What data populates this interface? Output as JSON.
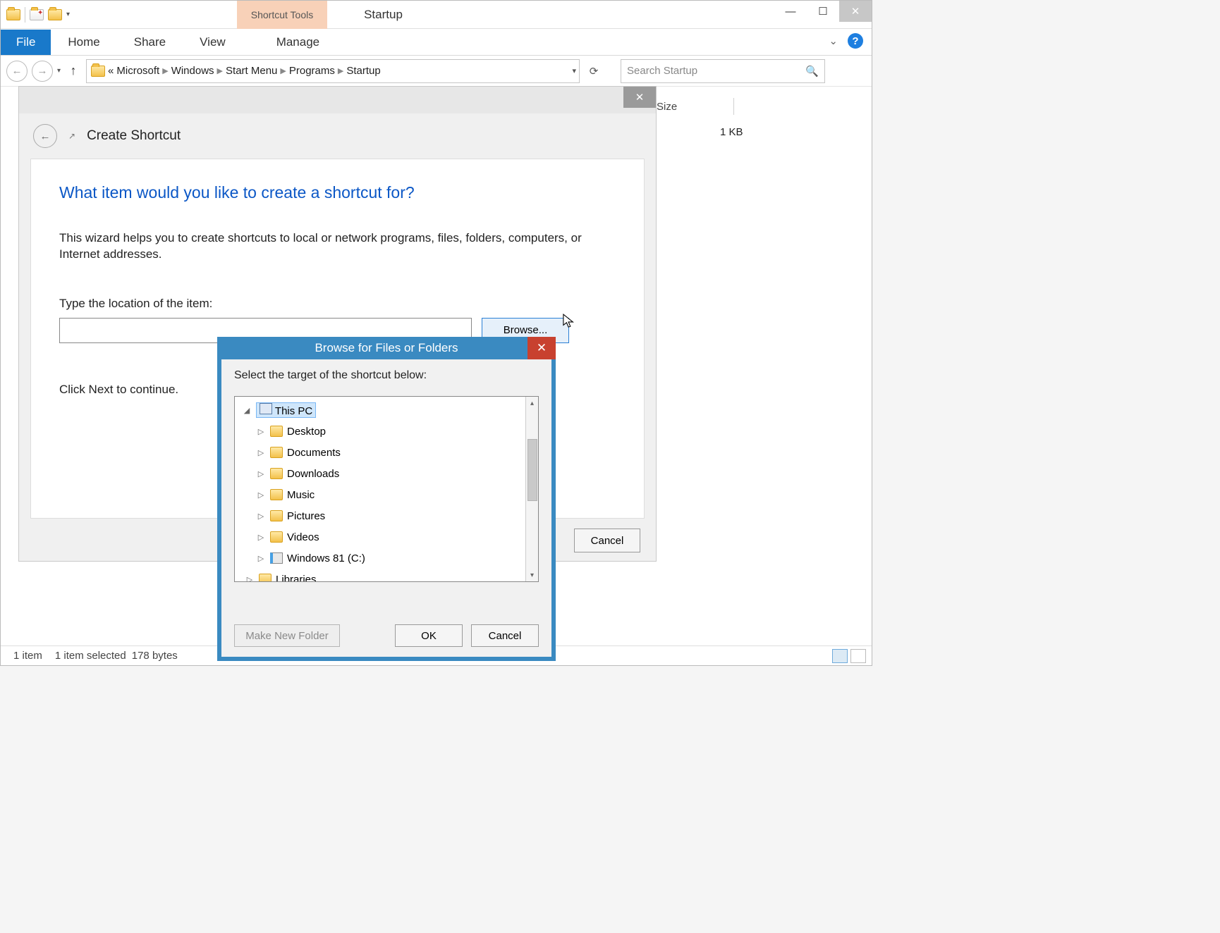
{
  "window": {
    "title": "Startup",
    "context_tab": "Shortcut Tools",
    "controls": {
      "minimize": "—",
      "maximize": "☐",
      "close": "✕"
    }
  },
  "ribbon": {
    "file": "File",
    "tabs": [
      "Home",
      "Share",
      "View",
      "Manage"
    ],
    "help": "?"
  },
  "nav": {
    "breadcrumb_prefix": "«",
    "crumbs": [
      "Microsoft",
      "Windows",
      "Start Menu",
      "Programs",
      "Startup"
    ],
    "search_placeholder": "Search Startup"
  },
  "columns": {
    "size_header": "Size",
    "size_value": "1 KB"
  },
  "statusbar": {
    "count": "1 item",
    "selection": "1 item selected",
    "bytes": "178 bytes"
  },
  "wizard": {
    "title": "Create Shortcut",
    "question": "What item would you like to create a shortcut for?",
    "description": "This wizard helps you to create shortcuts to local or network programs, files, folders, computers, or Internet addresses.",
    "location_label": "Type the location of the item:",
    "location_value": "",
    "browse": "Browse...",
    "continue_hint": "Click Next to continue.",
    "cancel": "Cancel"
  },
  "browse_dialog": {
    "title": "Browse for Files or Folders",
    "instruction": "Select the target of the shortcut below:",
    "tree": {
      "root": "This PC",
      "children": [
        "Desktop",
        "Documents",
        "Downloads",
        "Music",
        "Pictures",
        "Videos",
        "Windows 81 (C:)",
        "Libraries"
      ]
    },
    "make_new_folder": "Make New Folder",
    "ok": "OK",
    "cancel": "Cancel"
  }
}
